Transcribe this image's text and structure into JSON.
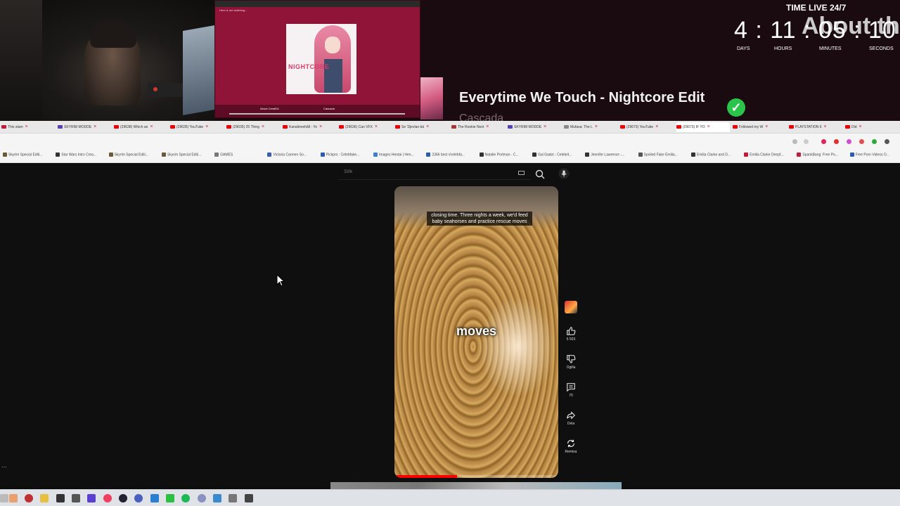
{
  "overlay": {
    "now_playing_title": "Everytime We Touch - Nightcore Edit",
    "now_playing_artist": "Cascada",
    "preview_logo": "NIGHTCORE",
    "preview_title": "Here is me watching...",
    "preview_footer_left": "About CreatEA",
    "preview_footer_center": "Cascada",
    "countdown": {
      "label": "TIME LIVE 24/7",
      "digits": "4 : 11 : 05 : 10",
      "overlay_text": "About th",
      "units": [
        "DAYS",
        "HOURS",
        "MINUTES",
        "SECONDS"
      ]
    }
  },
  "browser": {
    "tabs": [
      {
        "label": "This stam",
        "color": "#c41a3a"
      },
      {
        "label": "SKYRIM MODDE",
        "color": "#5a3fb0"
      },
      {
        "label": "(29638) Which an",
        "color": "#e00"
      },
      {
        "label": "(29635) YouTube",
        "color": "#e00"
      },
      {
        "label": "(29635) 25 Thing",
        "color": "#e00"
      },
      {
        "label": "Kanalinnehåll - Yo",
        "color": "#e00"
      },
      {
        "label": "(29636) Can VFX",
        "color": "#e00"
      },
      {
        "label": "Se 'Djevlan bä",
        "color": "#e00"
      },
      {
        "label": "The Rookie Next",
        "color": "#a33"
      },
      {
        "label": "SKYRIM MODDE",
        "color": "#5a3fb0"
      },
      {
        "label": "Mufasa: The L",
        "color": "#888"
      },
      {
        "label": "(29673) YouTube",
        "color": "#e00"
      },
      {
        "label": "(29673) IF YO",
        "color": "#e00"
      },
      {
        "label": "Followed my W",
        "color": "#e00"
      },
      {
        "label": "PLAYSTATION 6",
        "color": "#e00"
      },
      {
        "label": "Did",
        "color": "#e00"
      }
    ],
    "bookmarks": [
      {
        "label": "Skyrim Special Editi...",
        "color": "#6b5a3a"
      },
      {
        "label": "Star Wars Intro Crea...",
        "color": "#333"
      },
      {
        "label": "Skyrim Special Editi...",
        "color": "#6b5a3a"
      },
      {
        "label": "Skyrim Special Editi...",
        "color": "#6b5a3a"
      },
      {
        "label": "GAMES",
        "color": "#777"
      },
      {
        "label": "Victoria Carmen So...",
        "color": "#3b5bb0"
      },
      {
        "label": "Pickpro : Celebfake...",
        "color": "#2a5db0"
      },
      {
        "label": "Images Hentai | Hen...",
        "color": "#3a7fd0"
      },
      {
        "label": "2366 best r/celebfa...",
        "color": "#2a5db0"
      },
      {
        "label": "Natalie Portman - C...",
        "color": "#333"
      },
      {
        "label": "Gal Gadot - Celebrit...",
        "color": "#333"
      },
      {
        "label": "Jennifer Lawrence -...",
        "color": "#333"
      },
      {
        "label": "Spoiled Fake Emilia...",
        "color": "#555"
      },
      {
        "label": "Emilia Clarke and D...",
        "color": "#333"
      },
      {
        "label": "Emilia Clarke Deepf...",
        "color": "#c41a3a"
      },
      {
        "label": "SpankBang: Free Po...",
        "color": "#c41a3a"
      },
      {
        "label": "Free Porn Videos O...",
        "color": "#2a5db0"
      }
    ]
  },
  "youtube": {
    "search_placeholder": "Sök",
    "caption": "closing time. Three nights a week, we'd feed baby seahorses and practice rescue moves",
    "big_word": "moves",
    "progress_fraction": 0.38,
    "actions": {
      "likes": "6 503",
      "dislike": "Ogilla",
      "comments": "70",
      "share": "Dela",
      "remix": "Remixa"
    }
  }
}
